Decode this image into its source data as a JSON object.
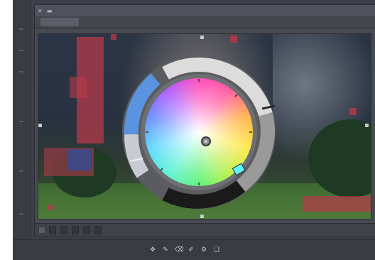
{
  "window": {
    "title": "",
    "tab_label": ""
  },
  "statusbar": {
    "fields": [
      "",
      "",
      "",
      "",
      ""
    ]
  },
  "icons": {
    "close": "close-icon",
    "minimize": "minimize-icon",
    "dock": [
      "move-icon",
      "brush-icon",
      "eraser-icon",
      "pen-icon",
      "gear-icon",
      "layers-icon"
    ]
  },
  "colors": {
    "accent_blue": "#5a93e0",
    "accent_cyan": "#5ff2ff",
    "mask_red": "#b63a4a",
    "mask_blue": "#2e4fa3",
    "ui_bg": "#3d4048"
  },
  "color_selector": {
    "selected_hue_marker": "cyan",
    "selector_ring": "gray-ring"
  }
}
